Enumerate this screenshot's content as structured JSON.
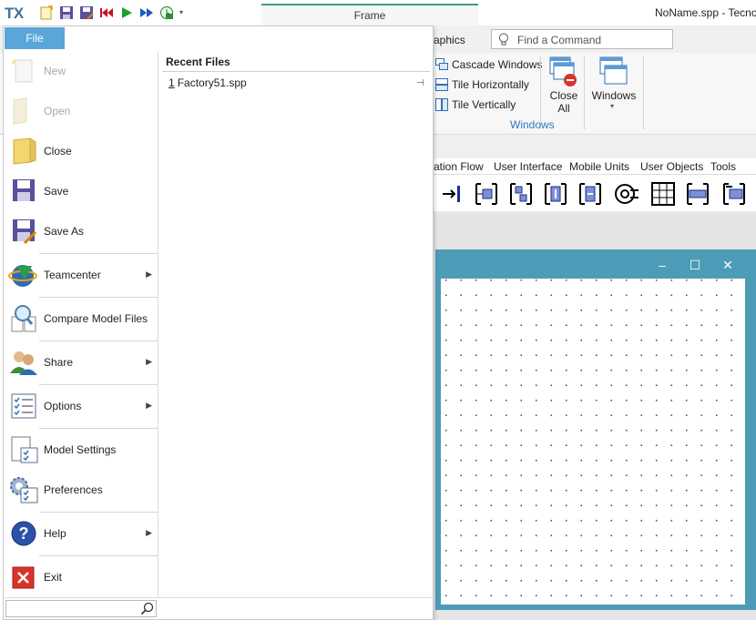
{
  "titlebar": {
    "logo": "TX",
    "frame_tab": "Frame",
    "document_title": "NoName.spp - Tecnom",
    "qat_icons": [
      "new-file-icon",
      "save-icon",
      "save-as-icon",
      "jump-start-icon",
      "play-icon",
      "fast-forward-icon",
      "clock-icon",
      "customize-dropdown-icon"
    ]
  },
  "ribbon": {
    "tab_partial": "aphics",
    "find_command_placeholder": "Find a Command",
    "windows_group": {
      "cascade": "Cascade Windows",
      "tile_h": "Tile Horizontally",
      "tile_v": "Tile Vertically",
      "close_all_line1": "Close",
      "close_all_line2": "All",
      "windows": "Windows",
      "group_label": "Windows"
    }
  },
  "library_tabs": [
    "ation Flow",
    "User Interface",
    "Mobile Units",
    "User Objects",
    "Tools"
  ],
  "child_window": {
    "minimize": "‒",
    "maximize": "☐",
    "close": "✕"
  },
  "file_menu": {
    "tab_label": "File",
    "items": [
      {
        "label": "New",
        "icon": "new-star-icon",
        "enabled": false
      },
      {
        "label": "Open",
        "icon": "open-folder-icon",
        "enabled": false
      },
      {
        "label": "Close",
        "icon": "close-folder-icon",
        "enabled": true
      },
      {
        "label": "Save",
        "icon": "floppy-icon",
        "enabled": true
      },
      {
        "label": "Save As",
        "icon": "floppy-pencil-icon",
        "enabled": true
      },
      {
        "label": "Teamcenter",
        "icon": "teamcenter-icon",
        "enabled": true,
        "submenu": true
      },
      {
        "label": "Compare Model Files",
        "icon": "magnifier-docs-icon",
        "enabled": true
      },
      {
        "label": "Share",
        "icon": "users-icon",
        "enabled": true,
        "submenu": true
      },
      {
        "label": "Options",
        "icon": "checklist-icon",
        "enabled": true,
        "submenu": true
      },
      {
        "label": "Model Settings",
        "icon": "document-check-icon",
        "enabled": true
      },
      {
        "label": "Preferences",
        "icon": "gear-check-icon",
        "enabled": true
      },
      {
        "label": "Help",
        "icon": "help-icon",
        "enabled": true,
        "submenu": true
      },
      {
        "label": "Exit",
        "icon": "exit-icon",
        "enabled": true
      }
    ],
    "recent_files_heading": "Recent Files",
    "recent_files": [
      {
        "index": "1",
        "name": "Factory51.spp"
      }
    ]
  },
  "colors": {
    "file_tab_bg": "#5aa6d8",
    "child_window_frame": "#4c9cb7",
    "group_label": "#2b79c2",
    "frame_tab_accent": "#3aa071"
  }
}
